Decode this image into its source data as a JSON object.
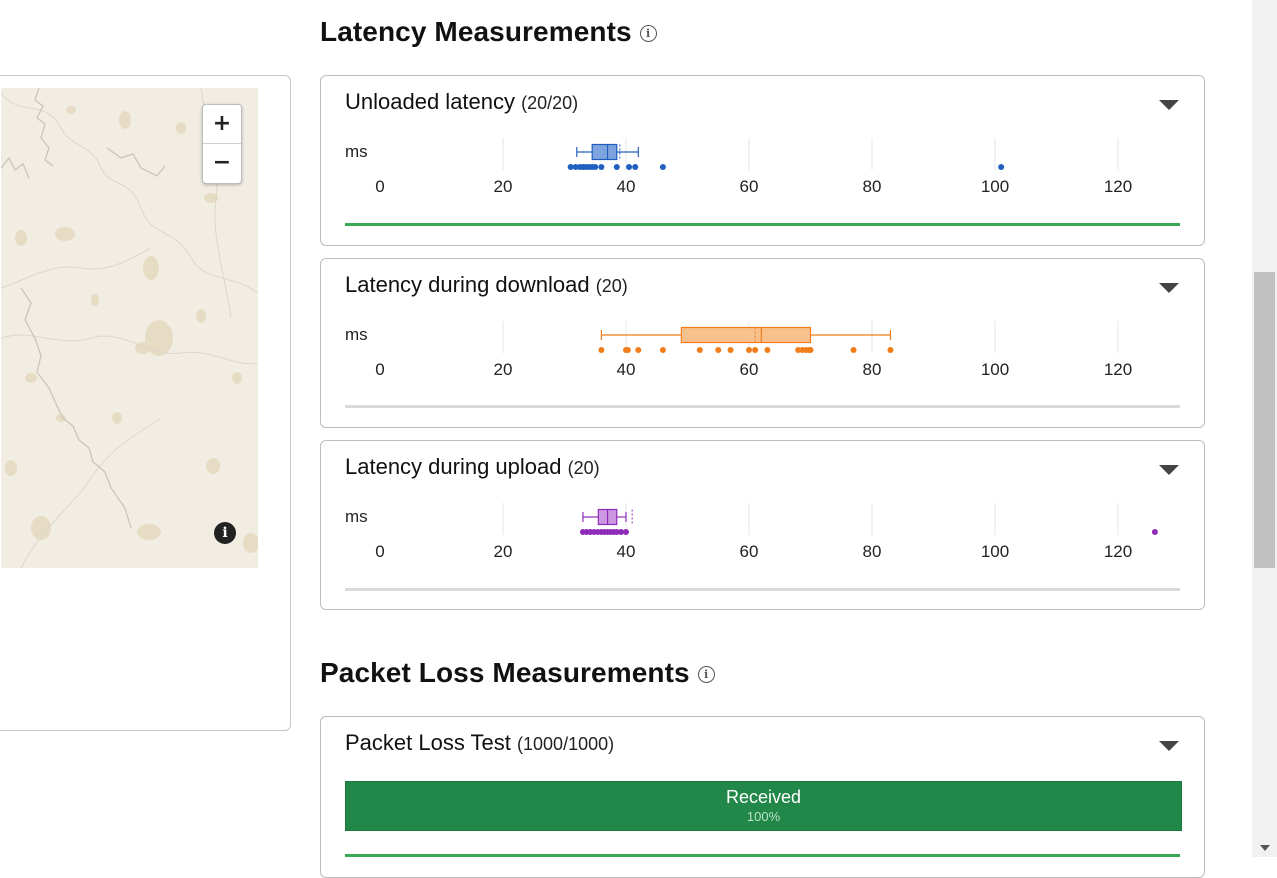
{
  "map": {
    "zoom_in_label": "+",
    "zoom_out_label": "−",
    "info_label": "i"
  },
  "latency": {
    "title": "Latency Measurements",
    "info_symbol": "ⓘ",
    "unit": "ms",
    "axis_ticks": [
      "0",
      "20",
      "40",
      "60",
      "80",
      "100",
      "120"
    ],
    "cards": [
      {
        "title": "Unloaded latency",
        "count": "(20/20)",
        "color": "#1f5fc0",
        "fill": "#7ea3df",
        "status_color": "#3aa757",
        "box": {
          "min": 32,
          "q1": 34.5,
          "median": 37,
          "q3": 38.5,
          "max": 42,
          "mean": 39
        },
        "points": [
          31,
          31.8,
          32.5,
          33,
          33.5,
          34,
          34.5,
          35,
          36,
          38.5,
          40.5,
          41.5,
          46,
          101
        ]
      },
      {
        "title": "Latency during download",
        "count": "(20)",
        "color": "#f07d1a",
        "fill": "#f8c28f",
        "status_color": "#d9d9d9",
        "box": {
          "min": 36,
          "q1": 49,
          "median": 62,
          "q3": 70,
          "max": 83,
          "mean": 61
        },
        "points": [
          36,
          40,
          40.3,
          42,
          46,
          52,
          55,
          57,
          60,
          61,
          63,
          68,
          68.7,
          69.3,
          69.8,
          70,
          77,
          83
        ]
      },
      {
        "title": "Latency during upload",
        "count": "(20)",
        "color": "#8e2bb8",
        "fill": "#cc98e2",
        "status_color": "#d9d9d9",
        "box": {
          "min": 33,
          "q1": 35.5,
          "median": 37,
          "q3": 38.5,
          "max": 40,
          "mean": 41
        },
        "points": [
          33,
          33.6,
          34.2,
          34.8,
          35.4,
          36,
          36.5,
          37,
          37.5,
          38,
          38.5,
          39.2,
          40,
          126
        ]
      }
    ]
  },
  "packet_loss": {
    "title": "Packet Loss Measurements",
    "info_symbol": "ⓘ",
    "card_title": "Packet Loss Test",
    "count": "(1000/1000)",
    "received_label": "Received",
    "received_percent": "100%",
    "bar_color": "#22884a",
    "status_color": "#3aa757"
  }
}
